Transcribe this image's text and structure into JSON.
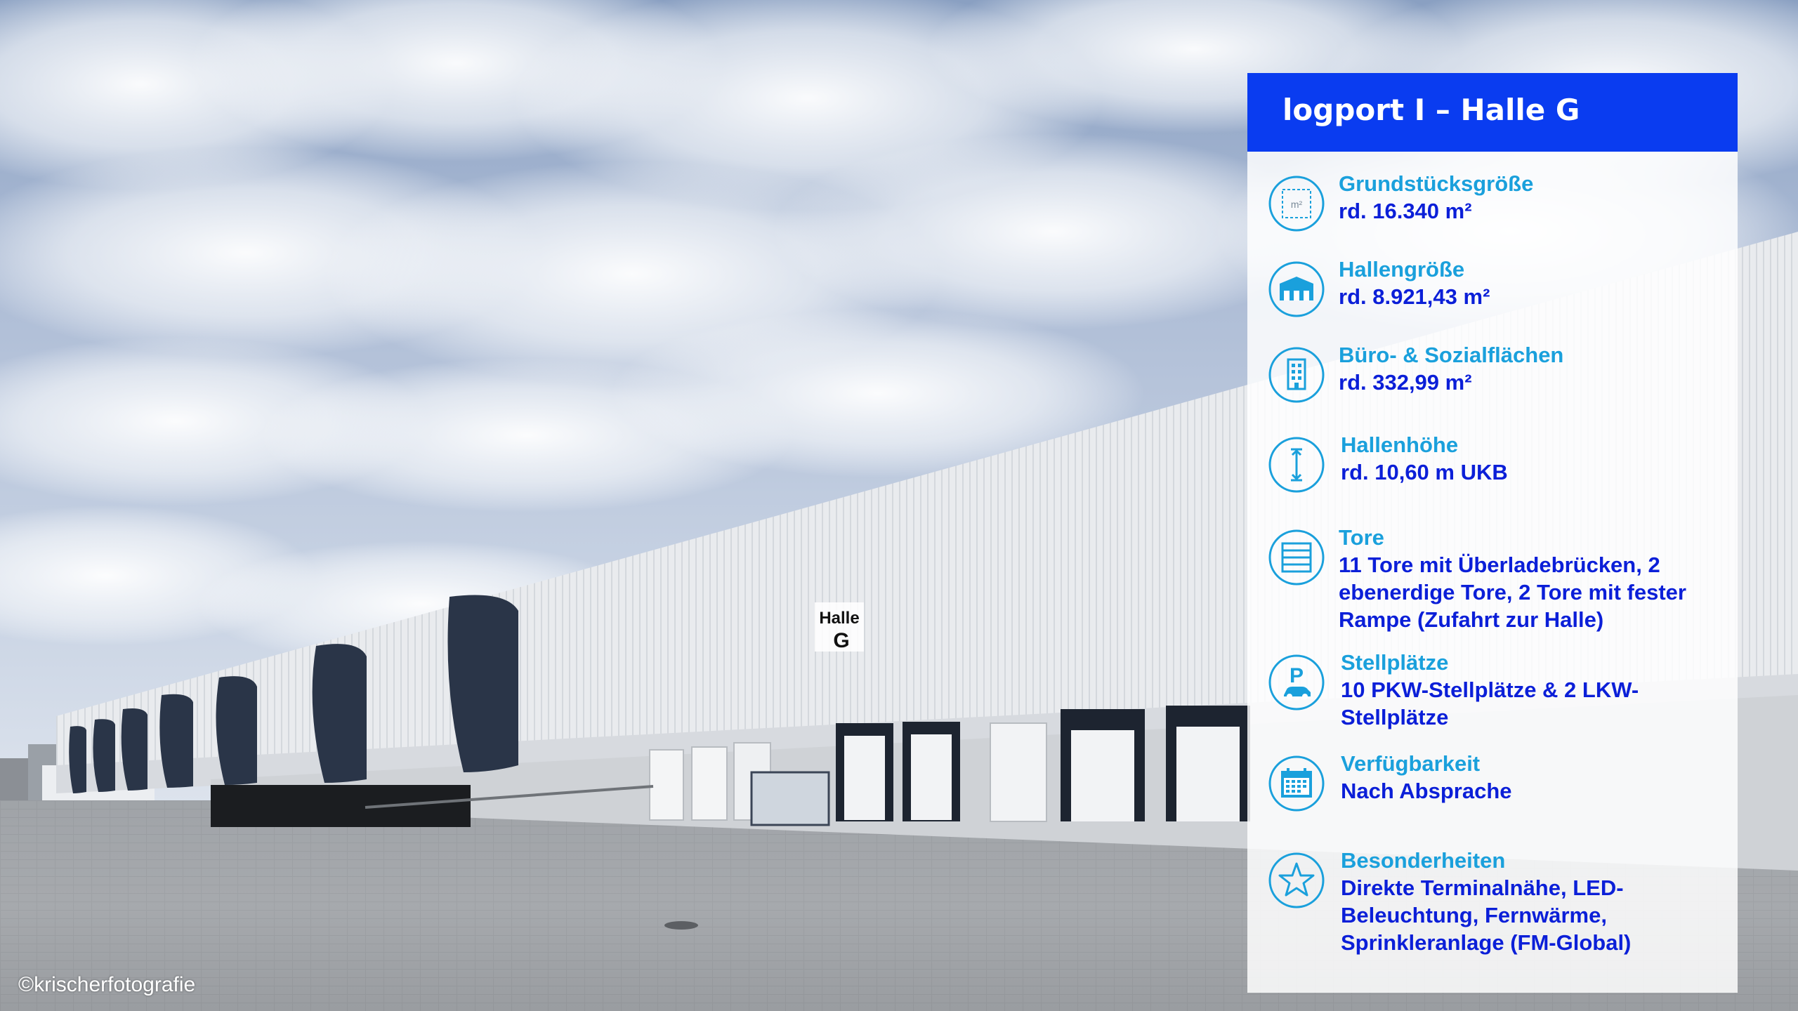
{
  "credit": "©krischerfotografie",
  "colors": {
    "header": "#0a3cf0",
    "label": "#1aa0dc",
    "value": "#0b1fd8"
  },
  "panel": {
    "title": "logport I – Halle G",
    "items": [
      {
        "icon": "plot-area-icon",
        "icon_text": "m²",
        "label": "Grundstücksgröße",
        "value": "rd. 16.340 m²"
      },
      {
        "icon": "warehouse-icon",
        "label": "Hallengröße",
        "value": "rd. 8.921,43 m²"
      },
      {
        "icon": "office-building-icon",
        "label": "Büro- & Sozialflächen",
        "value": "rd. 332,99 m²"
      },
      {
        "icon": "height-arrow-icon",
        "label": "Hallenhöhe",
        "value": "rd. 10,60 m UKB"
      },
      {
        "icon": "gate-icon",
        "label": "Tore",
        "value": "11 Tore mit Überladebrücken, 2 ebenerdige Tore, 2 Tore mit fester Rampe (Zufahrt zur Halle)"
      },
      {
        "icon": "parking-icon",
        "icon_text": "P",
        "label": "Stellplätze",
        "value": "10 PKW-Stellplätze & 2 LKW-Stellplätze"
      },
      {
        "icon": "calendar-icon",
        "label": "Verfügbarkeit",
        "value": "Nach Absprache"
      },
      {
        "icon": "star-icon",
        "label": "Besonderheiten",
        "value": "Direkte Terminalnähe, LED-Beleuchtung, Fernwärme, Sprinkleranlage (FM-Global)"
      }
    ]
  },
  "photo": {
    "building_sign": [
      "Halle",
      "G"
    ]
  }
}
